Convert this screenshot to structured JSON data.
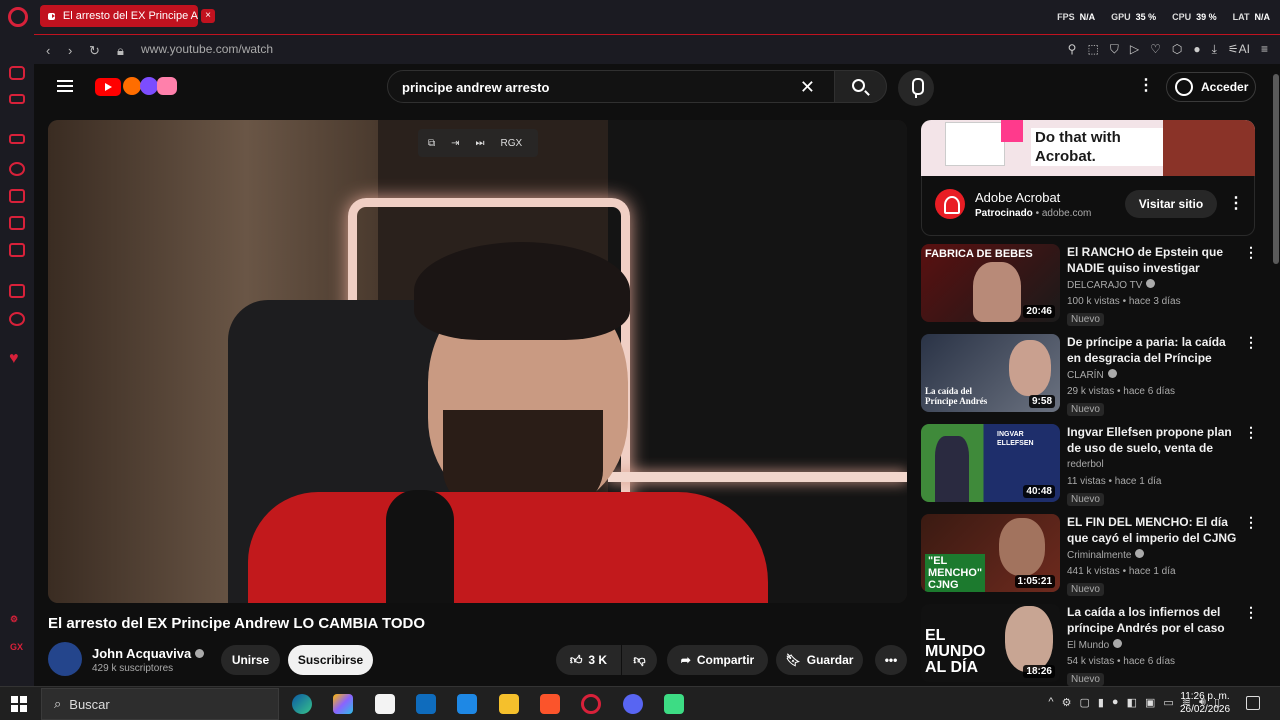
{
  "browser": {
    "tab_title": "El arresto del EX Principe A",
    "url": "www.youtube.com/watch",
    "stats": [
      {
        "label": "FPS",
        "value": "N/A"
      },
      {
        "label": "GPU",
        "value": "35 %"
      },
      {
        "label": "CPU",
        "value": "39 %"
      },
      {
        "label": "LAT",
        "value": "N/A"
      }
    ],
    "ai_label": "AI",
    "sidebar_gx": "GX"
  },
  "header": {
    "search_query": "principe andrew  arresto",
    "login_label": "Acceder"
  },
  "player": {
    "overlay_label": "RGX"
  },
  "video": {
    "title": "El arresto del EX Principe Andrew LO CAMBIA TODO",
    "channel": "John Acquaviva",
    "subscribers": "429 k suscriptores",
    "join_label": "Unirse",
    "subscribe_label": "Suscribirse",
    "likes": "3 K",
    "share_label": "Compartir",
    "save_label": "Guardar"
  },
  "ad": {
    "headline": "Do that with Acrobat.",
    "name": "Adobe Acrobat",
    "sponsored": "Patrocinado",
    "domain": "adobe.com",
    "cta": "Visitar sitio"
  },
  "recommendations": [
    {
      "title": "El RANCHO de Epstein que NADIE quiso investigar",
      "channel": "DELCARAJO TV",
      "meta": "100 k vistas • hace 3 días",
      "duration": "20:46",
      "badge": "Nuevo",
      "thumb_text": "FABRICA DE BEBES"
    },
    {
      "title": "De príncipe a paria: la caída en desgracia del Príncipe Andrés",
      "channel": "CLARÍN",
      "meta": "29 k vistas • hace 6 días",
      "duration": "9:58",
      "badge": "Nuevo",
      "thumb_text": "La caída del Príncipe Andrés"
    },
    {
      "title": "Ingvar Ellefsen propone plan de uso de suelo, venta de bonos ...",
      "channel": "rederbol",
      "meta": "11 vistas • hace 1 día",
      "duration": "40:48",
      "badge": "Nuevo",
      "thumb_text": "INGVAR ELLEFSEN"
    },
    {
      "title": "EL FIN DEL MENCHO: El día que cayó el imperio del CJNG",
      "channel": "Criminalmente",
      "meta": "441 k vistas • hace 1 día",
      "duration": "1:05:21",
      "badge": "Nuevo",
      "thumb_text": "\"EL MENCHO\" CJNG"
    },
    {
      "title": "La caída a los infiernos del príncipe Andrés por el caso ...",
      "channel": "El Mundo",
      "meta": "54 k vistas • hace 6 días",
      "duration": "18:26",
      "badge": "Nuevo",
      "thumb_text": "EL MUNDO AL DÍA"
    }
  ],
  "taskbar": {
    "search_placeholder": "Buscar",
    "time": "11:26 p. m.",
    "date": "26/02/2026"
  },
  "colors": {
    "opera_red": "#d8213a",
    "youtube_red": "#ff0000",
    "background": "#0f0f0f"
  }
}
